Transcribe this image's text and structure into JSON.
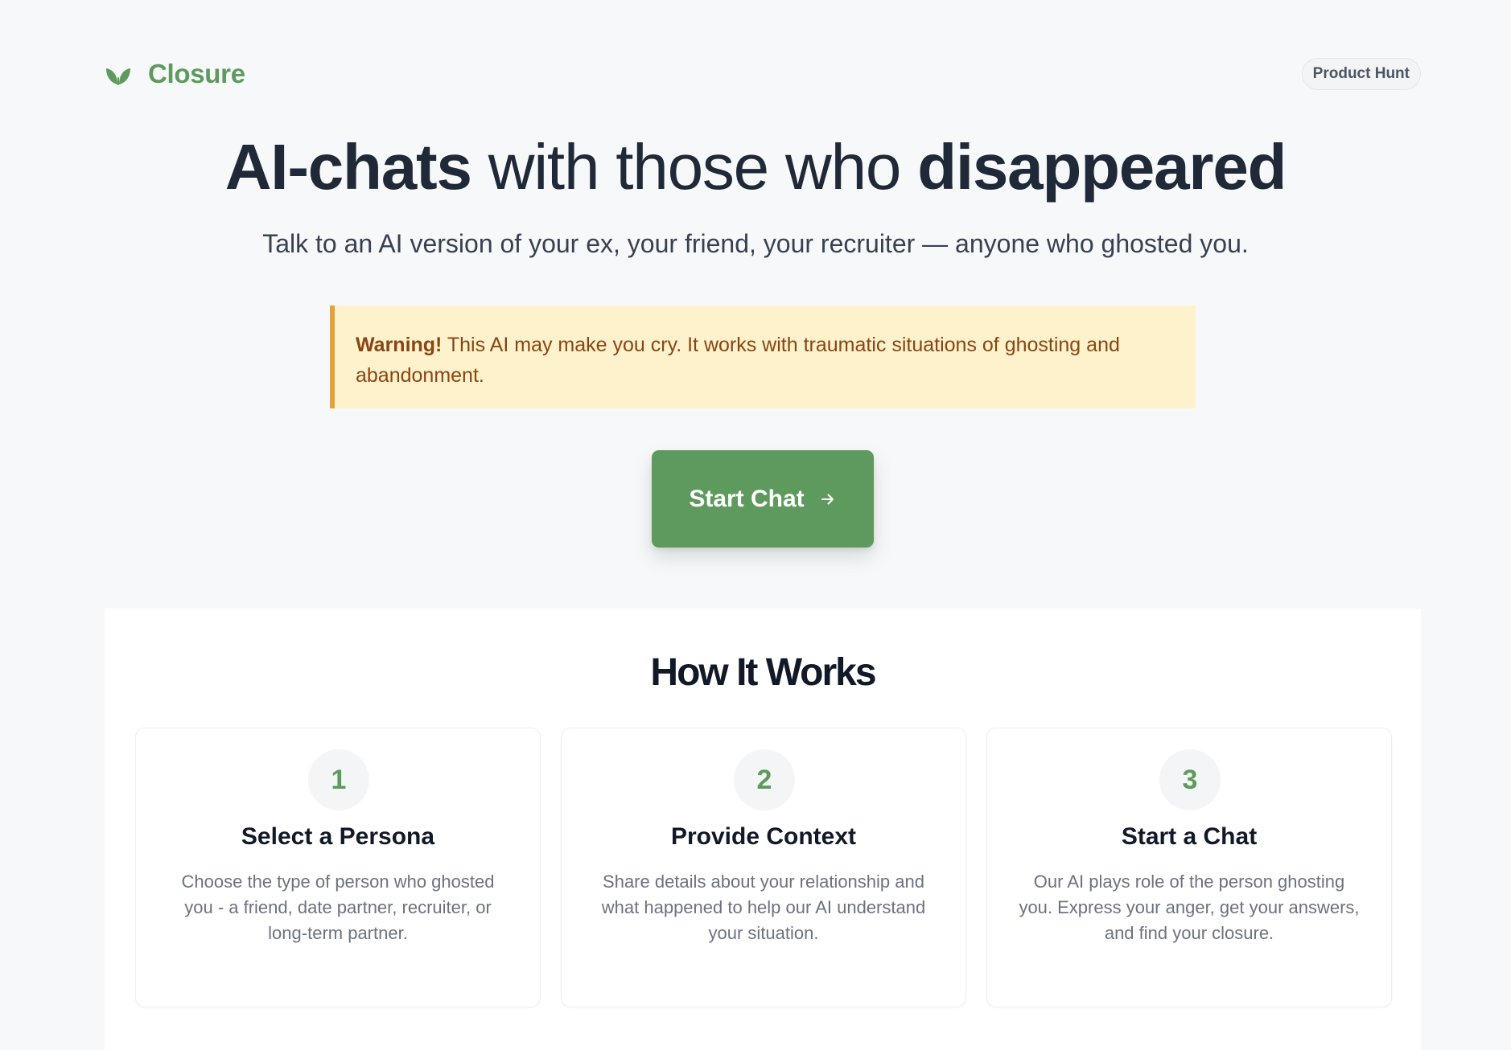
{
  "header": {
    "brand_name": "Closure",
    "brand_icon": "leaf-icon",
    "badge_label": "Product Hunt"
  },
  "hero": {
    "title_part1": "AI-chats",
    "title_part2": " with those who ",
    "title_part3": "disappeared",
    "subtitle": "Talk to an AI version of your ex, your friend, your recruiter — anyone who ghosted you."
  },
  "warning": {
    "label": "Warning!",
    "text": " This AI may make you cry. It works with traumatic situations of ghosting and abandonment."
  },
  "cta": {
    "label": "Start Chat",
    "icon": "arrow-right-icon"
  },
  "how_it_works": {
    "title": "How It Works",
    "steps": [
      {
        "number": "1",
        "title": "Select a Persona",
        "description": "Choose the type of person who ghosted you - a friend, date partner, recruiter, or long-term partner."
      },
      {
        "number": "2",
        "title": "Provide Context",
        "description": "Share details about your relationship and what happened to help our AI understand your situation."
      },
      {
        "number": "3",
        "title": "Start a Chat",
        "description": "Our AI plays role of the person ghosting you. Express your anger, get your answers, and find your closure."
      }
    ]
  },
  "colors": {
    "brand_green": "#5e9a5e",
    "warning_bg": "#fdf2cc",
    "warning_border": "#e3a23b",
    "warning_text": "#8a4513",
    "page_bg": "#f7f8fa"
  }
}
